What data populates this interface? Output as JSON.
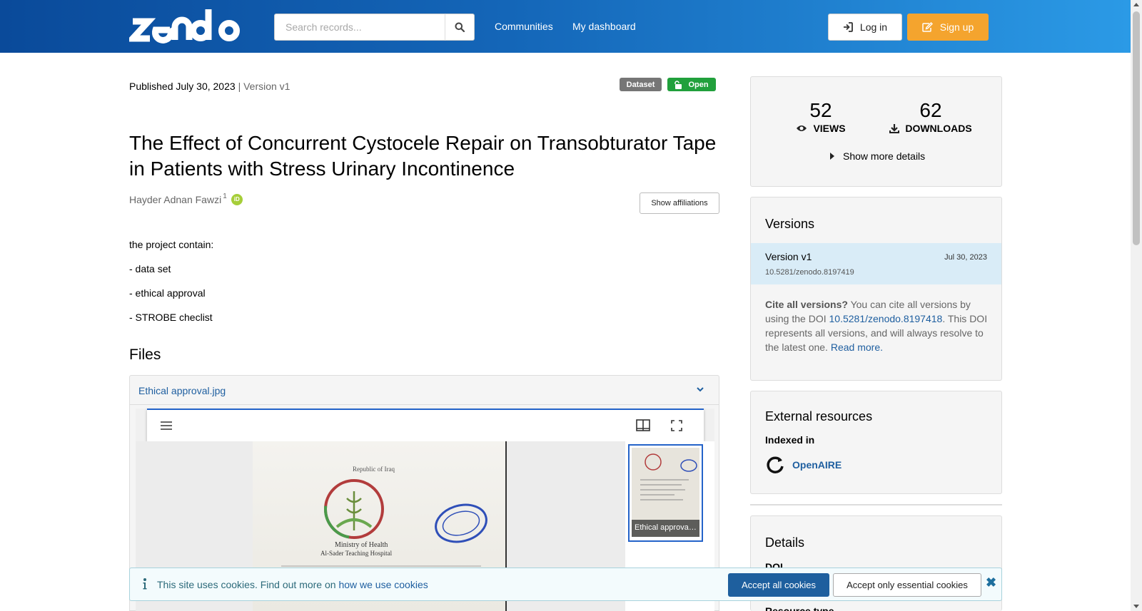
{
  "header": {
    "logo_text": "zenodo",
    "search_placeholder": "Search records...",
    "nav": [
      {
        "label": "Communities"
      },
      {
        "label": "My dashboard"
      }
    ],
    "login_label": "Log in",
    "signup_label": "Sign up"
  },
  "record": {
    "published_label": "Published July 30, 2023",
    "version_label": "| Version v1",
    "resource_badge": "Dataset",
    "access_badge": "Open",
    "title": "The Effect of Concurrent Cystocele Repair on Transobturator Tape in Patients with Stress Urinary Incontinence",
    "author": "Hayder Adnan Fawzi",
    "author_affil_num": "1",
    "orcid_label": "iD",
    "show_affiliations_label": "Show affiliations",
    "description": [
      "the project contain:",
      "- data set",
      "- ethical approval",
      "- STROBE checlist"
    ],
    "files_heading": "Files",
    "file_name": "Ethical approval.jpg",
    "thumb_label": "Ethical approval.jpg",
    "doc_text": {
      "line1": "Republic of Iraq",
      "line2": "Ministry of Health",
      "line3": "Al-Sader Teaching Hospital"
    }
  },
  "stats": {
    "views_count": "52",
    "views_label": "VIEWS",
    "downloads_count": "62",
    "downloads_label": "DOWNLOADS",
    "more_details_label": "Show more details"
  },
  "versions": {
    "heading": "Versions",
    "items": [
      {
        "label": "Version v1",
        "date": "Jul 30, 2023",
        "doi": "10.5281/zenodo.8197419"
      }
    ],
    "cite_bold": "Cite all versions?",
    "cite_text_1": " You can cite all versions by using the DOI ",
    "cite_doi": "10.5281/zenodo.8197418",
    "cite_text_2": ". This DOI represents all versions, and will always resolve to the latest one. ",
    "read_more": "Read more."
  },
  "external": {
    "heading": "External resources",
    "indexed_label": "Indexed in",
    "openaire_label": "OpenAIRE"
  },
  "details": {
    "heading": "Details",
    "doi_label": "DOI",
    "resource_type_label": "Resource type"
  },
  "cookie": {
    "text": "This site uses cookies. Find out more on ",
    "link": "how we use cookies",
    "accept_all": "Accept all cookies",
    "accept_essential": "Accept only essential cookies",
    "close": "✖"
  },
  "colors": {
    "accent": "#1f5fa0",
    "signup": "#f4a42e",
    "open_badge": "#21a03c",
    "dataset_badge": "#767676"
  }
}
